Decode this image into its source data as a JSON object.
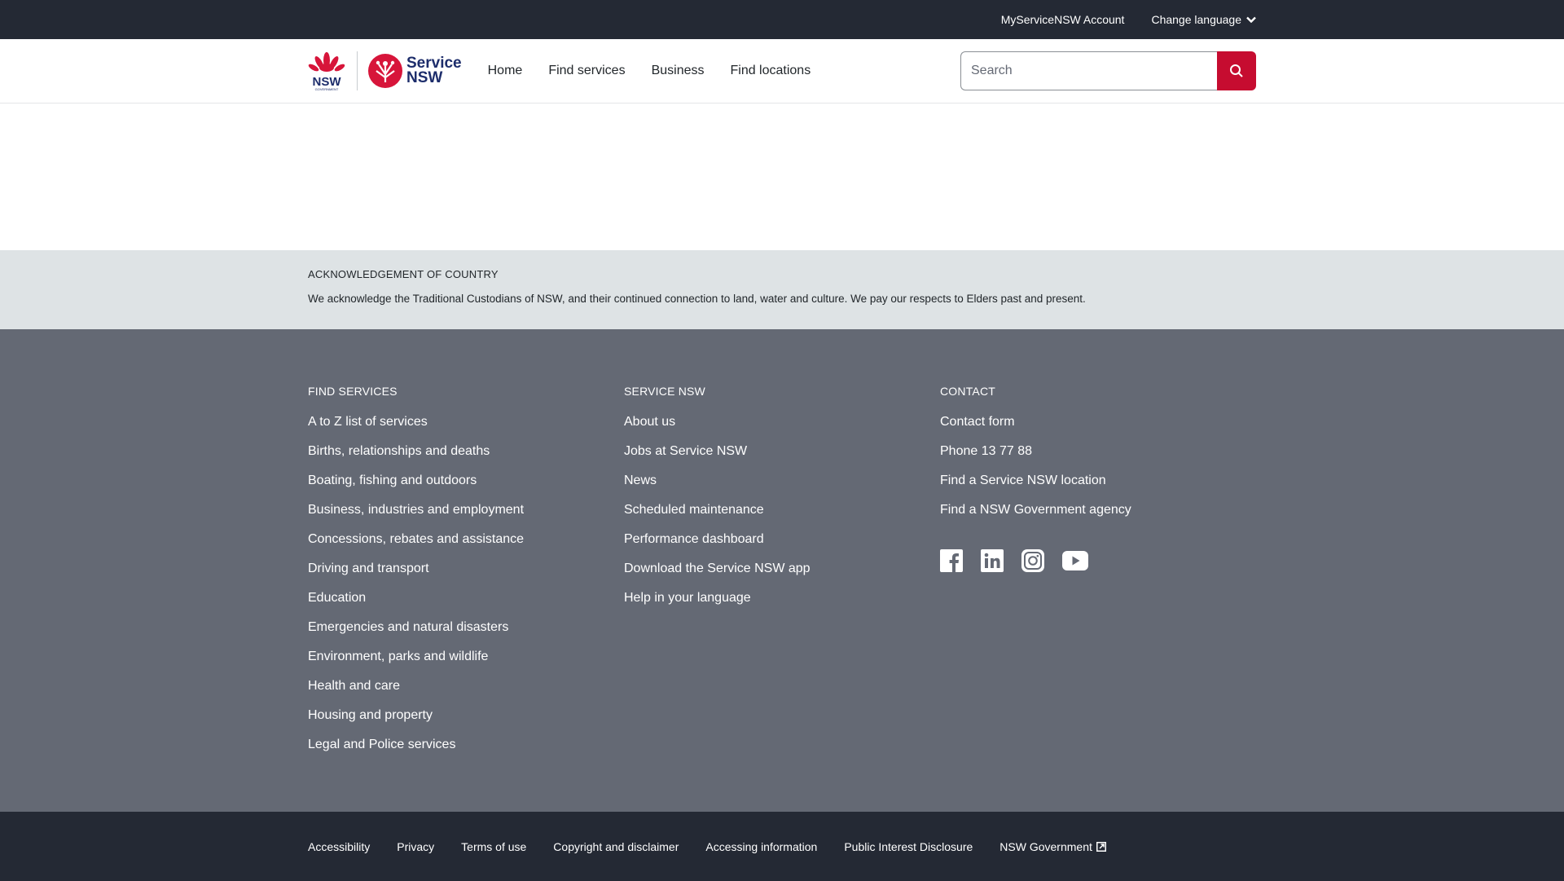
{
  "topbar": {
    "account_label": "MyServiceNSW Account",
    "language_label": "Change language"
  },
  "header": {
    "nsw_logo_text": "NSW",
    "nsw_logo_subtext": "GOVERNMENT",
    "service_logo_line1": "Service",
    "service_logo_line2": "NSW",
    "nav": [
      "Home",
      "Find services",
      "Business",
      "Find locations"
    ],
    "search_placeholder": "Search",
    "brand_color": "#c60c30",
    "logo_blue": "#1d2d6b"
  },
  "acknowledgement": {
    "title": "ACKNOWLEDGEMENT OF COUNTRY",
    "text": "We acknowledge the Traditional Custodians of NSW, and their continued connection to land, water and culture. We pay our respects to Elders past and present."
  },
  "footer": {
    "find_services": {
      "title": "FIND SERVICES",
      "links": [
        "A to Z list of services",
        "Births, relationships and deaths",
        "Boating, fishing and outdoors",
        "Business, industries and employment",
        "Concessions, rebates and assistance",
        "Driving and transport",
        "Education",
        "Emergencies and natural disasters",
        "Environment, parks and wildlife",
        "Health and care",
        "Housing and property",
        "Legal and Police services"
      ]
    },
    "service_nsw": {
      "title": "SERVICE NSW",
      "links": [
        "About us",
        "Jobs at Service NSW",
        "News",
        "Scheduled maintenance",
        "Performance dashboard",
        "Download the Service NSW app",
        "Help in your language"
      ]
    },
    "contact": {
      "title": "CONTACT",
      "links": [
        "Contact form",
        "Phone 13 77 88",
        "Find a Service NSW location",
        "Find a NSW Government agency"
      ],
      "social_icons": [
        "facebook-icon",
        "linkedin-icon",
        "instagram-icon",
        "youtube-icon"
      ]
    }
  },
  "bottombar": {
    "links": [
      "Accessibility",
      "Privacy",
      "Terms of use",
      "Copyright and disclaimer",
      "Accessing information",
      "Public Interest Disclosure",
      "NSW Government"
    ]
  }
}
